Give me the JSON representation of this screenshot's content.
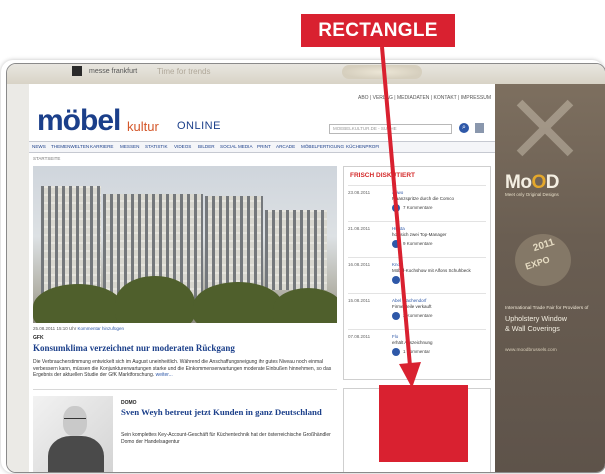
{
  "annotation": {
    "label": "RECTANGLE",
    "color": "#d92130"
  },
  "banner": {
    "logo_text": "messe frankfurt",
    "faint_text": "Time for trends"
  },
  "header": {
    "logo_main": "möbel",
    "logo_sub": "kultur",
    "logo_online": "ONLINE",
    "top_links": "ABO | VERLAG | MEDIADATEN | KONTAKT | IMPRESSUM",
    "search_placeholder": "MOEBELKULTUR.DE - SUCHE"
  },
  "nav": {
    "items": [
      "NEWS",
      "THEMENWELTEN",
      "KARRIERE",
      "MESSEN",
      "STATISTIK",
      "VIDEOS",
      "BILDER",
      "SOCIAL MEDIA",
      "PRINT",
      "ARCADE",
      "MÖBELFERTIGUNG",
      "KÜCHENPROFI"
    ]
  },
  "breadcrumb": "STARTSEITE",
  "article1": {
    "caption_date": "25.08.2011 15:10 Uhr",
    "caption_link": "Kommentar hinzufügen",
    "tag": "GFK",
    "headline": "Konsumklima verzeichnet nur moderaten Rückgang",
    "body": "Die Verbraucherstimmung entwickelt sich im August uneinheitlich. Während die Anschaffungsneigung ihr gutes Niveau noch einmal verbessern kann, müssen die Konjunkturerwartungen starke und die Einkommenserwartungen moderate Einbußen hinnehmen, so das Ergebnis der aktuellen Studie der GfK Marktforschung.",
    "more": "weiter..."
  },
  "article2": {
    "tag": "DOMO",
    "headline": "Sven Weyh betreut jetzt Kunden in ganz Deutschland",
    "body": "Sein komplettes Key-Account-Geschäft für Küchentechnik hat der österreichische Großhändler Domo der Handelsagentur"
  },
  "sidebar": {
    "title": "FRISCH DISKUTIERT",
    "items": [
      {
        "date": "23.08.2011",
        "line1": "Ariwo",
        "line2": "Finanzspritze durch die Comco",
        "comments": "7 Kommentare"
      },
      {
        "date": "21.08.2011",
        "line1": "Hülsta",
        "line2": "holt sich zwei Top-Manager",
        "comments": "9 Kommentare"
      },
      {
        "date": "16.08.2011",
        "line1": "Knoll",
        "line2": "Möbel-Kochshow mit Alfons Schuhbeck",
        "comments": ""
      },
      {
        "date": "15.08.2011",
        "line1": "Abel Wachendorf",
        "line2": "Firmenteile verkauft",
        "comments": "2 Kommentare"
      },
      {
        "date": "07.08.2011",
        "line1": "Flo",
        "line2": "erhält Auszeichnung",
        "comments": "1 Kommentar"
      }
    ]
  },
  "right_ad": {
    "brand_pre": "Mo",
    "brand_o": "O",
    "brand_post": "D",
    "tagline": "Meet only Original Designs",
    "year": "2011",
    "expo": "EXPO",
    "text1": "International Trade Fair for Providers of",
    "text2": "Upholstery  Window",
    "text3": "& Wall Coverings",
    "url": "www.moodbrussels.com"
  }
}
